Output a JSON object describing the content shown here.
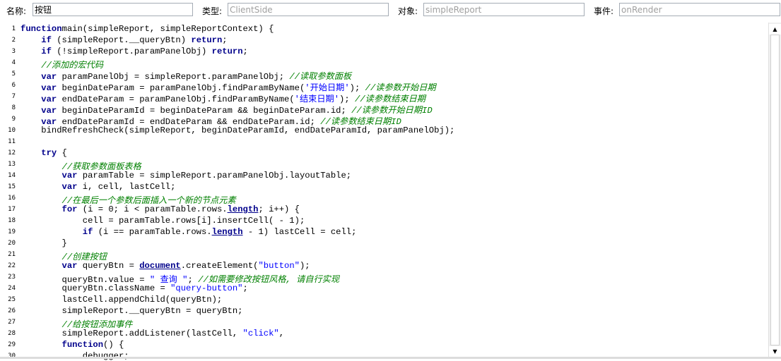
{
  "header": {
    "name_label": "名称:",
    "name_value": "按钮",
    "type_label": "类型:",
    "type_placeholder": "ClientSide",
    "object_label": "对象:",
    "object_placeholder": "simpleReport",
    "event_label": "事件:",
    "event_placeholder": "onRender"
  },
  "editor": {
    "lines": [
      {
        "n": "1",
        "segs": [
          [
            "kw",
            "function"
          ],
          [
            "",
            "main(simpleReport, simpleReportContext) {"
          ]
        ]
      },
      {
        "n": "2",
        "segs": [
          [
            "",
            "    "
          ],
          [
            "kw",
            "if"
          ],
          [
            "",
            " (simpleReport.__queryBtn) "
          ],
          [
            "kw",
            "return"
          ],
          [
            "",
            ";"
          ]
        ]
      },
      {
        "n": "3",
        "segs": [
          [
            "",
            "    "
          ],
          [
            "kw",
            "if"
          ],
          [
            "",
            " (!simpleReport.paramPanelObj) "
          ],
          [
            "kw",
            "return"
          ],
          [
            "",
            ";"
          ]
        ]
      },
      {
        "n": "4",
        "segs": [
          [
            "",
            "    "
          ],
          [
            "cm",
            "//添加的宏代码"
          ]
        ]
      },
      {
        "n": "5",
        "segs": [
          [
            "",
            "    "
          ],
          [
            "kw",
            "var"
          ],
          [
            "",
            " paramPanelObj = simpleReport.paramPanelObj; "
          ],
          [
            "cm",
            "//读取参数面板"
          ]
        ]
      },
      {
        "n": "6",
        "segs": [
          [
            "",
            "    "
          ],
          [
            "kw",
            "var"
          ],
          [
            "",
            " beginDateParam = paramPanelObj.findParamByName("
          ],
          [
            "str",
            "'开始日期'"
          ],
          [
            "",
            "); "
          ],
          [
            "cm",
            "//读参数开始日期"
          ]
        ]
      },
      {
        "n": "7",
        "segs": [
          [
            "",
            "    "
          ],
          [
            "kw",
            "var"
          ],
          [
            "",
            " endDateParam = paramPanelObj.findParamByName("
          ],
          [
            "str",
            "'结束日期'"
          ],
          [
            "",
            "); "
          ],
          [
            "cm",
            "//读参数结束日期"
          ]
        ]
      },
      {
        "n": "8",
        "segs": [
          [
            "",
            "    "
          ],
          [
            "kw",
            "var"
          ],
          [
            "",
            " beginDateParamId = beginDateParam && beginDateParam.id; "
          ],
          [
            "cm",
            "//读参数开始日期ID"
          ]
        ]
      },
      {
        "n": "9",
        "segs": [
          [
            "",
            "    "
          ],
          [
            "kw",
            "var"
          ],
          [
            "",
            " endDateParamId = endDateParam && endDateParam.id; "
          ],
          [
            "cm",
            "//读参数结束日期ID"
          ]
        ]
      },
      {
        "n": "10",
        "segs": [
          [
            "",
            "    bindRefreshCheck(simpleReport, beginDateParamId, endDateParamId, paramPanelObj);"
          ]
        ]
      },
      {
        "n": "11",
        "segs": [
          [
            "",
            ""
          ]
        ]
      },
      {
        "n": "12",
        "segs": [
          [
            "",
            "    "
          ],
          [
            "kw",
            "try"
          ],
          [
            "",
            " {"
          ]
        ]
      },
      {
        "n": "13",
        "segs": [
          [
            "",
            "        "
          ],
          [
            "cm",
            "//获取参数面板表格"
          ]
        ]
      },
      {
        "n": "14",
        "segs": [
          [
            "",
            "        "
          ],
          [
            "kw",
            "var"
          ],
          [
            "",
            " paramTable = simpleReport.paramPanelObj.layoutTable;"
          ]
        ]
      },
      {
        "n": "15",
        "segs": [
          [
            "",
            "        "
          ],
          [
            "kw",
            "var"
          ],
          [
            "",
            " i, cell, lastCell;"
          ]
        ]
      },
      {
        "n": "16",
        "segs": [
          [
            "",
            "        "
          ],
          [
            "cm",
            "//在最后一个参数后面插入一个新的节点元素"
          ]
        ]
      },
      {
        "n": "17",
        "segs": [
          [
            "",
            "        "
          ],
          [
            "kw",
            "for"
          ],
          [
            "",
            " (i = 0; i < paramTable.rows."
          ],
          [
            "prop",
            "length"
          ],
          [
            "",
            "; i++) {"
          ]
        ]
      },
      {
        "n": "18",
        "segs": [
          [
            "",
            "            cell = paramTable.rows[i].insertCell( - 1);"
          ]
        ]
      },
      {
        "n": "19",
        "segs": [
          [
            "",
            "            "
          ],
          [
            "kw",
            "if"
          ],
          [
            "",
            " (i == paramTable.rows."
          ],
          [
            "prop",
            "length"
          ],
          [
            "",
            " - 1) lastCell = cell;"
          ]
        ]
      },
      {
        "n": "20",
        "segs": [
          [
            "",
            "        }"
          ]
        ]
      },
      {
        "n": "21",
        "segs": [
          [
            "",
            "        "
          ],
          [
            "cm",
            "//创建按钮"
          ]
        ]
      },
      {
        "n": "22",
        "segs": [
          [
            "",
            "        "
          ],
          [
            "kw",
            "var"
          ],
          [
            "",
            " queryBtn = "
          ],
          [
            "prop",
            "document"
          ],
          [
            "",
            ".createElement("
          ],
          [
            "str",
            "\"button\""
          ],
          [
            "",
            ");"
          ]
        ]
      },
      {
        "n": "23",
        "segs": [
          [
            "",
            "        queryBtn.value = "
          ],
          [
            "str",
            "\" 查询 \""
          ],
          [
            "",
            "; "
          ],
          [
            "cm",
            "//如需要修改按钮风格, 请自行实现"
          ]
        ]
      },
      {
        "n": "24",
        "segs": [
          [
            "",
            "        queryBtn.className = "
          ],
          [
            "str",
            "\"query-button\""
          ],
          [
            "",
            ";"
          ]
        ]
      },
      {
        "n": "25",
        "segs": [
          [
            "",
            "        lastCell.appendChild(queryBtn);"
          ]
        ]
      },
      {
        "n": "26",
        "segs": [
          [
            "",
            "        simpleReport.__queryBtn = queryBtn;"
          ]
        ]
      },
      {
        "n": "27",
        "segs": [
          [
            "",
            "        "
          ],
          [
            "cm",
            "//给按钮添加事件"
          ]
        ]
      },
      {
        "n": "28",
        "segs": [
          [
            "",
            "        simpleReport.addListener(lastCell, "
          ],
          [
            "str",
            "\"click\""
          ],
          [
            "",
            ","
          ]
        ]
      },
      {
        "n": "29",
        "segs": [
          [
            "",
            "        "
          ],
          [
            "kw",
            "function"
          ],
          [
            "",
            "() {"
          ]
        ]
      },
      {
        "n": "30",
        "segs": [
          [
            "",
            "            debugger;"
          ]
        ]
      }
    ]
  },
  "scrollbar": {
    "up_icon": "▲",
    "down_icon": "▼"
  }
}
